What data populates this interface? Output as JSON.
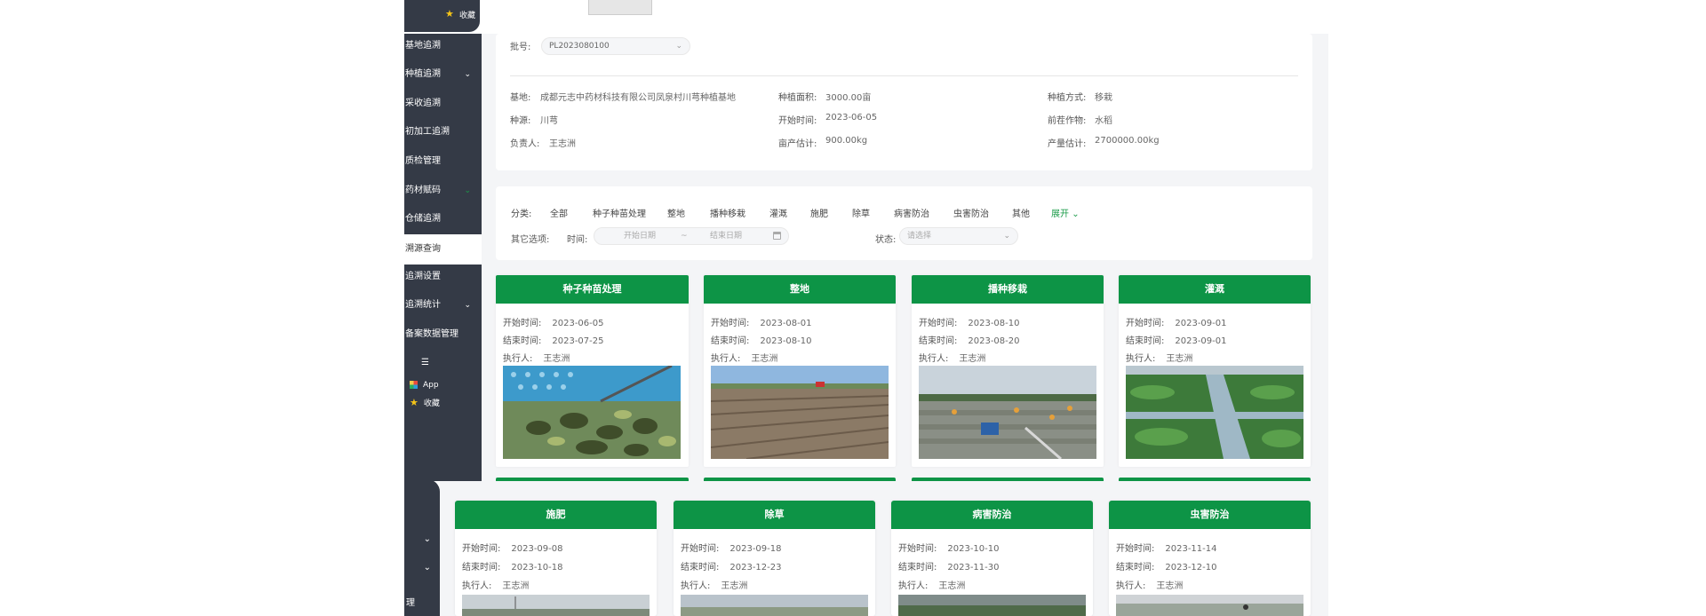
{
  "sidebar": {
    "top_favorite": "收藏",
    "items": [
      {
        "label": "基地追溯",
        "chevron": false
      },
      {
        "label": "种植追溯",
        "chevron": true
      },
      {
        "label": "采收追溯",
        "chevron": false
      },
      {
        "label": "初加工追溯",
        "chevron": false
      },
      {
        "label": "质检管理",
        "chevron": false
      },
      {
        "label": "药材赋码",
        "chevron": true
      },
      {
        "label": "仓储追溯",
        "chevron": true
      },
      {
        "label": "溯源查询",
        "chevron": false
      },
      {
        "label": "追溯设置",
        "chevron": true
      },
      {
        "label": "追溯统计",
        "chevron": true
      },
      {
        "label": "备案数据管理",
        "chevron": false
      }
    ],
    "collapse_icon": "☰",
    "app_label": "App",
    "favorite_label": "收藏"
  },
  "batch": {
    "label": "批号:",
    "value": "PL2023080100"
  },
  "info": {
    "base_label": "基地:",
    "base_value": "成都元志中药材科技有限公司凤泉村川芎种植基地",
    "area_label": "种植面积:",
    "area_value": "3000.00亩",
    "method_label": "种植方式:",
    "method_value": "移栽",
    "source_label": "种源:",
    "source_value": "川芎",
    "start_label": "开始时间:",
    "start_value": "2023-06-05",
    "prev_crop_label": "前茬作物:",
    "prev_crop_value": "水稻",
    "owner_label": "负责人:",
    "owner_value": "王志洲",
    "yield_per_label": "亩产估计:",
    "yield_per_value": "900.00kg",
    "yield_total_label": "产量估计:",
    "yield_total_value": "2700000.00kg"
  },
  "filter": {
    "category_label": "分类:",
    "categories": [
      "全部",
      "种子种苗处理",
      "整地",
      "播种移栽",
      "灌溉",
      "施肥",
      "除草",
      "病害防治",
      "虫害防治",
      "其他"
    ],
    "expand_label": "展开",
    "other_label": "其它选项:",
    "time_label": "时间:",
    "start_placeholder": "开始日期",
    "range_sep": "~",
    "end_placeholder": "结束日期",
    "status_label": "状态:",
    "status_placeholder": "请选择"
  },
  "card_labels": {
    "start": "开始时间:",
    "end": "结束时间:",
    "executor": "执行人:"
  },
  "cards_top": [
    {
      "title": "种子种苗处理",
      "start": "2023-06-05",
      "end": "2023-07-25",
      "executor": "王志洲"
    },
    {
      "title": "整地",
      "start": "2023-08-01",
      "end": "2023-08-10",
      "executor": "王志洲"
    },
    {
      "title": "播种移栽",
      "start": "2023-08-10",
      "end": "2023-08-20",
      "executor": "王志洲"
    },
    {
      "title": "灌溉",
      "start": "2023-09-01",
      "end": "2023-09-01",
      "executor": "王志洲"
    }
  ],
  "cards_bottom": [
    {
      "title": "施肥",
      "start": "2023-09-08",
      "end": "2023-10-18",
      "executor": "王志洲"
    },
    {
      "title": "除草",
      "start": "2023-09-18",
      "end": "2023-12-23",
      "executor": "王志洲"
    },
    {
      "title": "病害防治",
      "start": "2023-10-10",
      "end": "2023-11-30",
      "executor": "王志洲"
    },
    {
      "title": "虫害防治",
      "start": "2023-11-14",
      "end": "2023-12-10",
      "executor": "王志洲"
    }
  ],
  "lower_sidebar_fragment": "理",
  "colors": {
    "sidebar": "#343a46",
    "accent": "#0d9446",
    "background": "#f4f5f7"
  }
}
